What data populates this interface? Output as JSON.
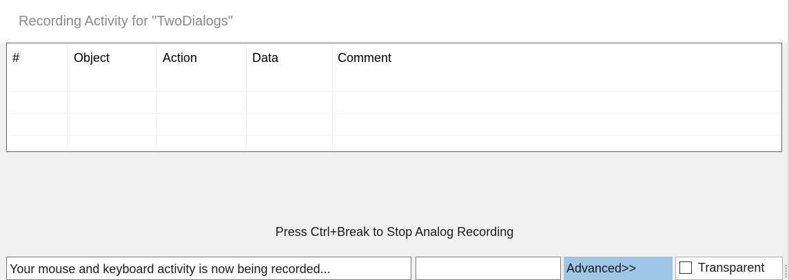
{
  "window": {
    "title": "Recording Activity for \"TwoDialogs\""
  },
  "grid": {
    "columns": [
      "#",
      "Object",
      "Action",
      "Data",
      "Comment"
    ],
    "rows": []
  },
  "hint": "Press Ctrl+Break to Stop Analog Recording",
  "status": {
    "message": "Your mouse and keyboard activity is now being recorded...",
    "secondary_value": ""
  },
  "buttons": {
    "advanced_label": "Advanced>>"
  },
  "transparent": {
    "label": "Transparent",
    "checked": false
  },
  "colors": {
    "advanced_button_bg": "#9fc6e7",
    "title_text": "#8a8a8a"
  }
}
